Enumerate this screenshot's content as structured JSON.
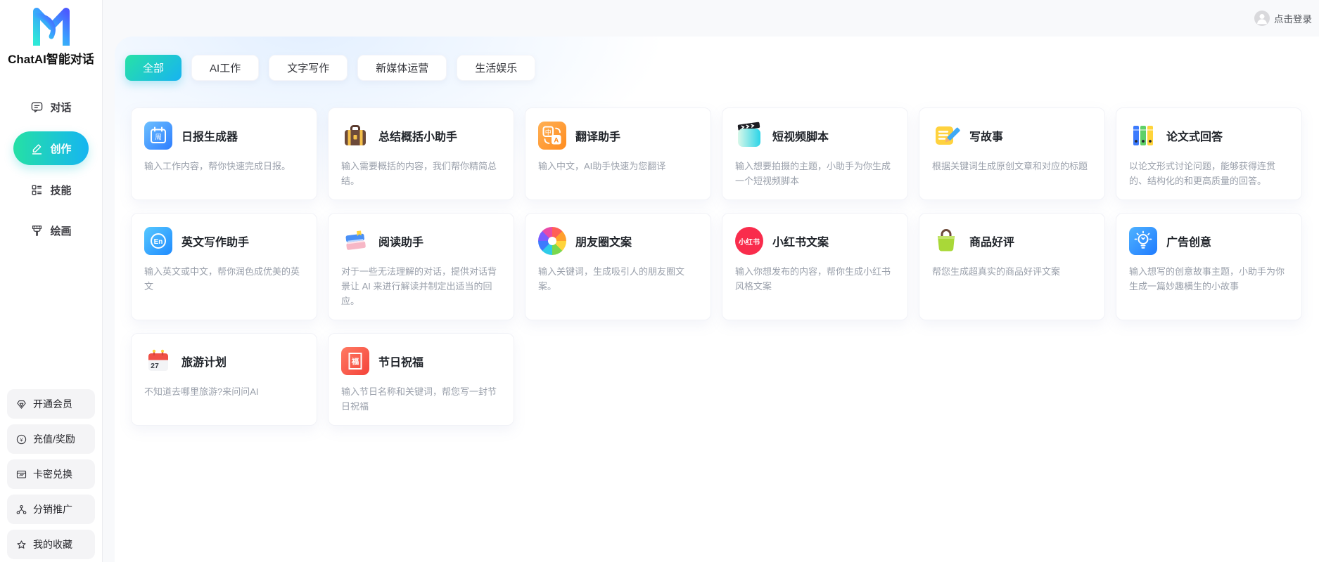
{
  "brand": {
    "title": "ChatAI智能对话",
    "logo_icon": "brand-m-logo"
  },
  "header": {
    "login_label": "点击登录",
    "avatar_icon": "user-avatar-icon"
  },
  "sidebar": {
    "nav": [
      {
        "id": "chat",
        "label": "对话",
        "icon": "chat-bubble-icon",
        "active": false
      },
      {
        "id": "create",
        "label": "创作",
        "icon": "pencil-icon",
        "active": true
      },
      {
        "id": "skills",
        "label": "技能",
        "icon": "grid-icon",
        "active": false
      },
      {
        "id": "draw",
        "label": "绘画",
        "icon": "brush-icon",
        "active": false
      }
    ],
    "footer": [
      {
        "id": "vip",
        "label": "开通会员",
        "icon": "gem-icon"
      },
      {
        "id": "recharge",
        "label": "充值/奖励",
        "icon": "coin-icon",
        "icon_text": "¥"
      },
      {
        "id": "redeem",
        "label": "卡密兑换",
        "icon": "card-icon"
      },
      {
        "id": "affiliate",
        "label": "分销推广",
        "icon": "network-icon"
      },
      {
        "id": "favorites",
        "label": "我的收藏",
        "icon": "star-icon"
      }
    ]
  },
  "tabs": [
    {
      "label": "全部",
      "active": true
    },
    {
      "label": "AI工作",
      "active": false
    },
    {
      "label": "文字写作",
      "active": false
    },
    {
      "label": "新媒体运营",
      "active": false
    },
    {
      "label": "生活娱乐",
      "active": false
    }
  ],
  "cards": [
    {
      "title": "日报生成器",
      "desc": "输入工作内容，帮你快速完成日报。",
      "icon": "daily-report-calendar-icon",
      "icon_text": "周"
    },
    {
      "title": "总结概括小助手",
      "desc": "输入需要概括的内容，我们帮你精简总结。",
      "icon": "briefcase-icon"
    },
    {
      "title": "翻译助手",
      "desc": "输入中文，AI助手快速为您翻译",
      "icon": "translate-icon",
      "icon_text": "中A"
    },
    {
      "title": "短视频脚本",
      "desc": "输入想要拍摄的主题，小助手为你生成一个短视频脚本",
      "icon": "video-clip-icon"
    },
    {
      "title": "写故事",
      "desc": "根据关键词生成原创文章和对应的标题",
      "icon": "note-pencil-icon"
    },
    {
      "title": "论文式回答",
      "desc": "以论文形式讨论问题，能够获得连贯的、结构化的和更高质量的回答。",
      "icon": "binders-icon"
    },
    {
      "title": "英文写作助手",
      "desc": "输入英文或中文，帮你润色成优美的英文",
      "icon": "english-en-icon",
      "icon_text": "En"
    },
    {
      "title": "阅读助手",
      "desc": "对于一些无法理解的对话，提供对话背景让 AI 来进行解读并制定出适当的回应。",
      "icon": "books-icon"
    },
    {
      "title": "朋友圈文案",
      "desc": "输入关键词，生成吸引人的朋友圈文案。",
      "icon": "color-wheel-icon"
    },
    {
      "title": "小红书文案",
      "desc": "输入你想发布的内容，帮你生成小红书风格文案",
      "icon": "xiaohongshu-icon",
      "icon_text": "小红书"
    },
    {
      "title": "商品好评",
      "desc": "帮您生成超真实的商品好评文案",
      "icon": "shopping-bag-icon"
    },
    {
      "title": "广告创意",
      "desc": "输入想写的创意故事主题，小助手为你生成一篇妙趣横生的小故事",
      "icon": "lightbulb-icon"
    },
    {
      "title": "旅游计划",
      "desc": "不知道去哪里旅游?来问问AI",
      "icon": "travel-calendar-icon",
      "icon_text": "27"
    },
    {
      "title": "节日祝福",
      "desc": "输入节日名称和关键词，帮您写一封节日祝福",
      "icon": "festival-fu-icon",
      "icon_text": "福"
    }
  ],
  "colors": {
    "accent_gradient_start": "#27e2a6",
    "accent_gradient_end": "#17b3f1",
    "xiaohongshu_red": "#f92c4c",
    "panel_bg": "#ffffff",
    "page_bg": "#f8f9fb"
  }
}
